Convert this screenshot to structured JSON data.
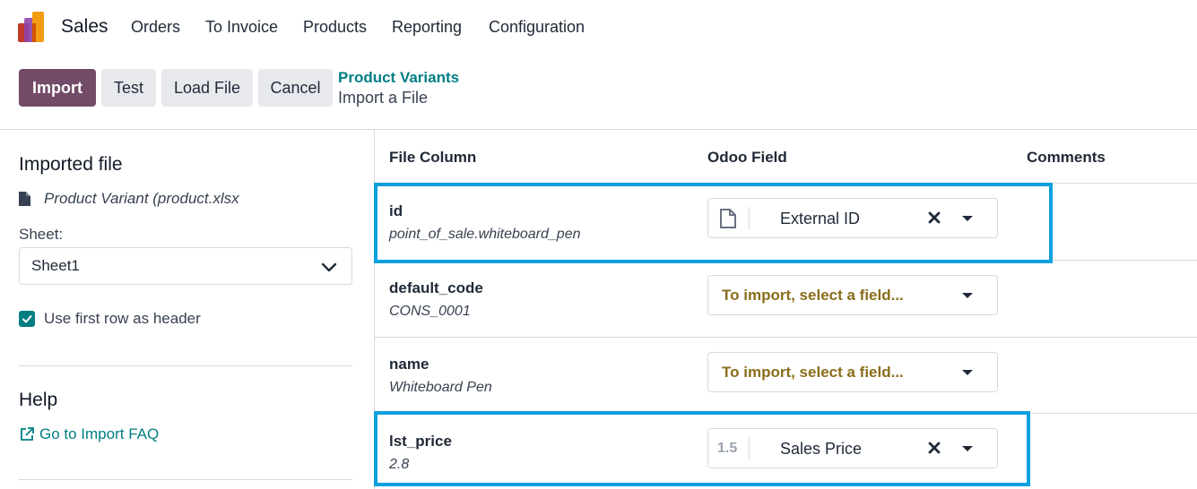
{
  "navbar": {
    "app_name": "Sales",
    "menus": [
      "Orders",
      "To Invoice",
      "Products",
      "Reporting",
      "Configuration"
    ]
  },
  "control_panel": {
    "buttons": {
      "import": "Import",
      "test": "Test",
      "load_file": "Load File",
      "cancel": "Cancel"
    },
    "breadcrumb": {
      "parent": "Product Variants",
      "current": "Import a File"
    }
  },
  "sidebar": {
    "imported_file_title": "Imported file",
    "file_name": "Product Variant (product.xlsx",
    "sheet_label": "Sheet:",
    "sheet_value": "Sheet1",
    "first_row_header_label": "Use first row as header",
    "first_row_header_checked": true,
    "help_title": "Help",
    "faq_link": "Go to Import FAQ"
  },
  "table": {
    "headers": {
      "file_column": "File Column",
      "odoo_field": "Odoo Field",
      "comments": "Comments"
    },
    "rows": [
      {
        "column": "id",
        "sample": "point_of_sale.whiteboard_pen",
        "field": "External ID",
        "type_icon": "file-icon",
        "placeholder": ""
      },
      {
        "column": "default_code",
        "sample": "CONS_0001",
        "field": "",
        "type_icon": "",
        "placeholder": "To import, select a field..."
      },
      {
        "column": "name",
        "sample": "Whiteboard Pen",
        "field": "",
        "type_icon": "",
        "placeholder": "To import, select a field..."
      },
      {
        "column": "lst_price",
        "sample": "2.8",
        "field": "Sales Price",
        "type_icon": "1.5",
        "placeholder": ""
      }
    ]
  },
  "colors": {
    "primary": "#714b67",
    "link": "#017e84",
    "placeholder": "#8a6d1b",
    "highlight": "#0aa0dc"
  }
}
